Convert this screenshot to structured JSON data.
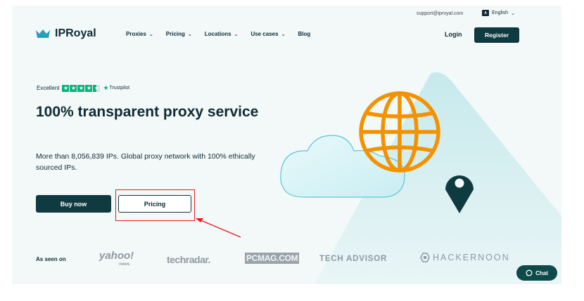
{
  "topbar": {
    "support_email": "support@iproyal.com",
    "language": "English",
    "lang_icon_text": "A"
  },
  "brand": {
    "name": "IPRoyal"
  },
  "nav": {
    "items": [
      {
        "label": "Proxies",
        "has_dropdown": true
      },
      {
        "label": "Pricing",
        "has_dropdown": true
      },
      {
        "label": "Locations",
        "has_dropdown": true
      },
      {
        "label": "Use cases",
        "has_dropdown": true
      },
      {
        "label": "Blog",
        "has_dropdown": false
      }
    ],
    "login_label": "Login",
    "register_label": "Register"
  },
  "hero": {
    "trust_label": "Excellent",
    "trust_brand": "Trustpilot",
    "headline": "100% transparent proxy service",
    "subtext": "More than 8,056,839 IPs. Global proxy network with 100% ethically sourced IPs.",
    "buy_label": "Buy now",
    "pricing_label": "Pricing"
  },
  "seen_on": {
    "label": "As seen on",
    "brands": [
      "yahoo!",
      "news",
      "techradar.",
      "PCMAG.COM",
      "TECH ADVISOR",
      "HACKERNOON"
    ]
  },
  "chat": {
    "label": "Chat"
  },
  "colors": {
    "primary": "#0f3a40",
    "accent_orange": "#f39200",
    "trustpilot_green": "#00b67a",
    "annotation_red": "#e02020",
    "background": "#f3f8f9"
  }
}
